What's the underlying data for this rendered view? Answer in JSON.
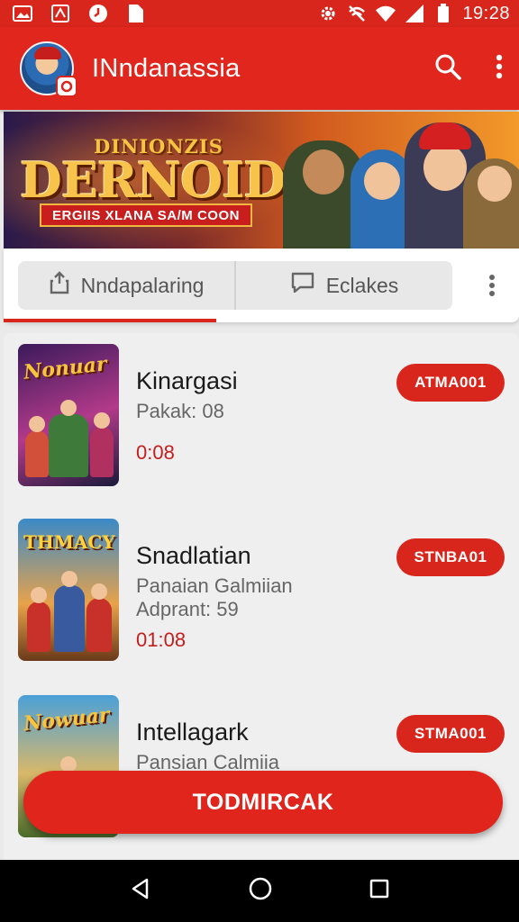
{
  "status_bar": {
    "time": "19:28",
    "left_icons": [
      "image-icon",
      "pdf-icon",
      "clock-icon",
      "document-icon"
    ],
    "right_icons": [
      "settings-icon",
      "no-signal-icon",
      "wifi-icon",
      "cell-signal-icon",
      "battery-icon"
    ]
  },
  "app_bar": {
    "title": "INndanassia",
    "actions": [
      "search-icon",
      "more-vert-icon"
    ]
  },
  "banner": {
    "subtitle_top": "DINIONZIS",
    "title": "DERNOIDAH",
    "tagline": "ERGIIS XLANA SA/M COON"
  },
  "tabs": [
    {
      "label": "Nndapalaring",
      "icon": "share-upload-icon",
      "selected": true
    },
    {
      "label": "Eclakes",
      "icon": "chat-bubble-icon",
      "selected": false
    }
  ],
  "list": {
    "items": [
      {
        "title": "Kinargasi",
        "sub": "Pakak: 08",
        "sub2": "",
        "time": "0:08",
        "badge": "ATMA001",
        "thumb_label": "Nonuar"
      },
      {
        "title": "Snadlatian",
        "sub": "Panaian Galmiian",
        "sub2": "Adprant: 59",
        "time": "01:08",
        "badge": "STNBA01",
        "thumb_label": "THMACY"
      },
      {
        "title": "Intellagark",
        "sub": "Pansian Calmiia",
        "sub2": "",
        "time": "",
        "badge": "STMA001",
        "thumb_label": "Nowuar"
      }
    ]
  },
  "fab": {
    "label": "TODMIRCAK"
  },
  "nav_bar": {
    "buttons": [
      "back-icon",
      "home-icon",
      "recents-icon"
    ]
  },
  "colors": {
    "primary": "#e1261d",
    "accent_text": "#c41d1d",
    "background": "#eaeaea"
  }
}
